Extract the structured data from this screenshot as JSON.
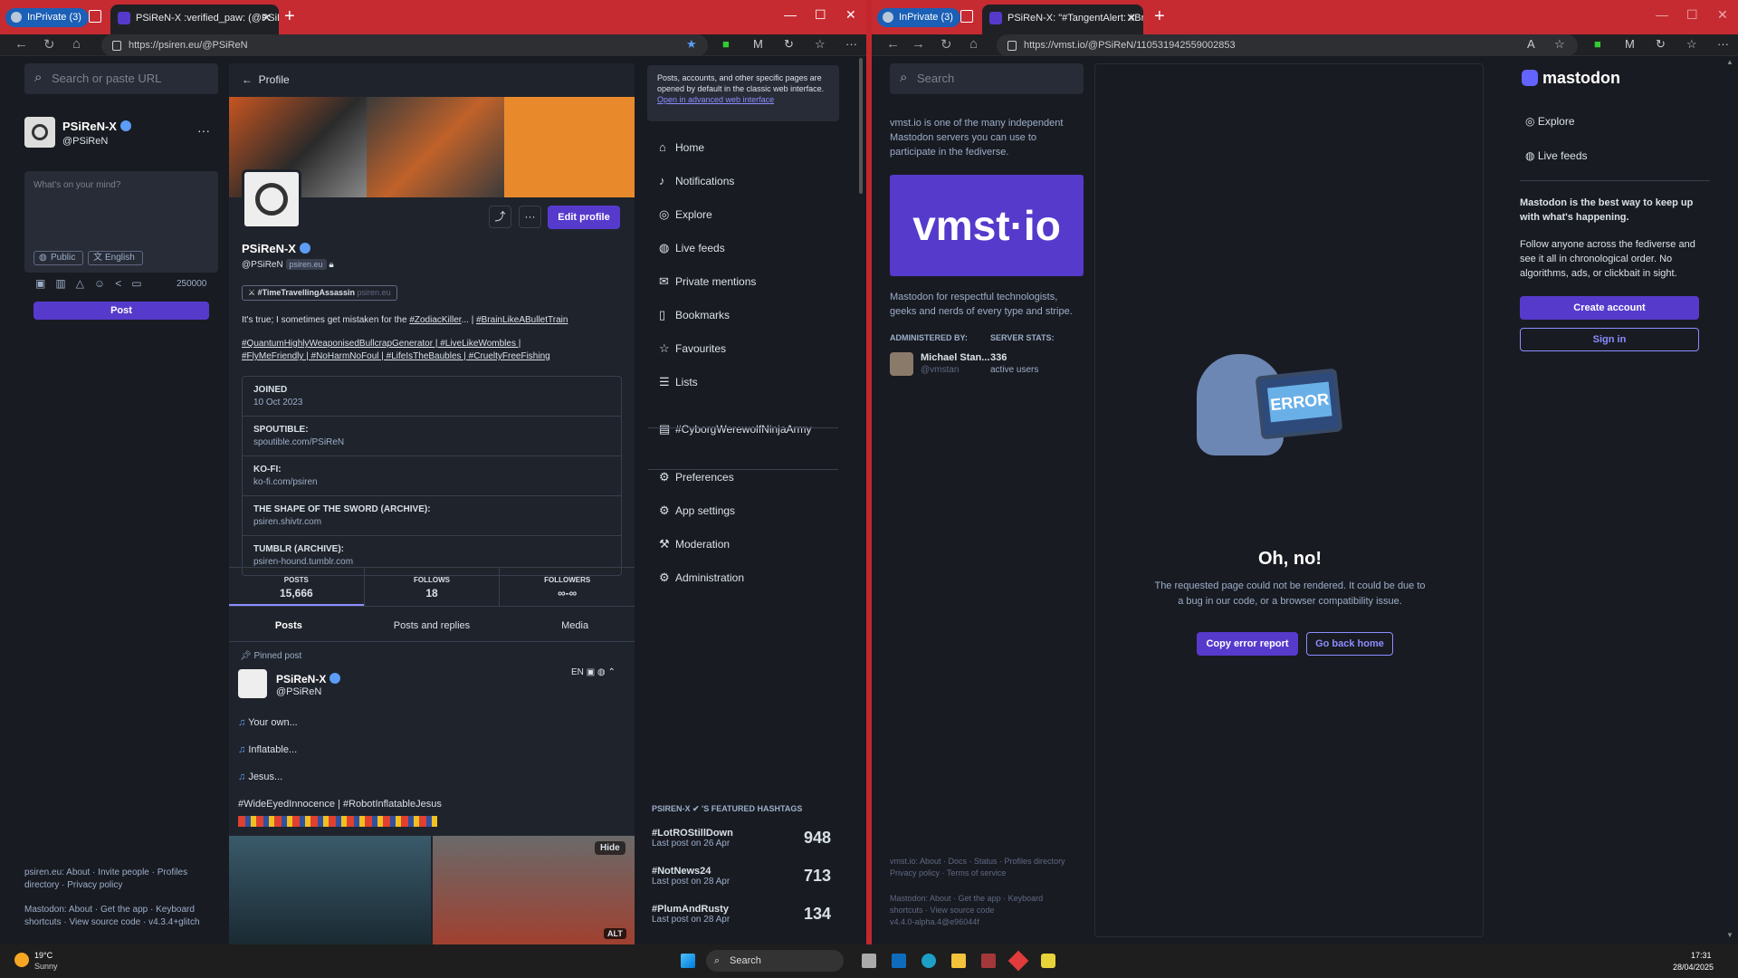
{
  "left_browser": {
    "inprivate": "InPrivate (3)",
    "tab_title": "PSiReN-X :verified_paw: (@PSiRe…",
    "url": "https://psiren.eu/@PSiReN"
  },
  "right_browser": {
    "inprivate": "InPrivate (3)",
    "tab_title": "PSiReN-X: \"#TangentAlert: #Braci…",
    "url": "https://vmst.io/@PSiReN/110531942559002853"
  },
  "compose": {
    "search_placeholder": "Search or paste URL",
    "account_name": "PSiReN-X",
    "account_handle": "@PSiReN",
    "textarea_placeholder": "What's on your mind?",
    "visibility": "Public",
    "language": "English",
    "char_count": "250000",
    "post_label": "Post"
  },
  "profile": {
    "back_label": "Profile",
    "edit_label": "Edit profile",
    "display_name": "PSiReN-X",
    "handle": "@PSiReN",
    "domain_badge": "psiren.eu",
    "featured_tag": "#TimeTravellingAssassin",
    "featured_tag_domain": "psiren.eu",
    "bio_line1_text": "It's true; I sometimes get mistaken for the ",
    "bio_line1_link1": "#ZodiacKiller",
    "bio_line1_mid": "... | ",
    "bio_line1_link2": "#BrainLikeABulletTrain",
    "bio_line2": "#QuantumHighlyWeaponisedBullcrapGenerator | #LiveLikeWombles |",
    "bio_line3": "#FlyMeFriendly | #NoHarmNoFoul | #LifeIsTheBaubles | #CrueltyFreeFishing",
    "fields": [
      {
        "k": "JOINED",
        "v": "10 Oct 2023"
      },
      {
        "k": "SPOUTIBLE:",
        "v": "spoutible.com/PSiReN"
      },
      {
        "k": "KO-FI:",
        "v": "ko-fi.com/psiren"
      },
      {
        "k": "THE SHAPE OF THE SWORD (ARCHIVE):",
        "v": "psiren.shivtr.com"
      },
      {
        "k": "TUMBLR (ARCHIVE):",
        "v": "psiren-hound.tumblr.com"
      }
    ],
    "stats": [
      {
        "label": "POSTS",
        "value": "15,666"
      },
      {
        "label": "FOLLOWS",
        "value": "18"
      },
      {
        "label": "FOLLOWERS",
        "value": "∞-∞"
      }
    ],
    "tabs": [
      "Posts",
      "Posts and replies",
      "Media"
    ],
    "pinned_label": "Pinned post",
    "post_author": "PSiReN-X",
    "post_handle": "@PSiReN",
    "post_lang": "EN",
    "post_lines": [
      "Your own...",
      "Inflatable...",
      "Jesus..."
    ],
    "post_tags": "#WideEyedInnocence | #RobotInflatableJesus",
    "hide_label": "Hide",
    "alt_label": "ALT"
  },
  "left_footer": {
    "line1": "psiren.eu: About · Invite people · Profiles directory · Privacy policy",
    "line2": "Mastodon: About · Get the app · Keyboard shortcuts · View source code · v4.3.4+glitch"
  },
  "sidebar": {
    "notice": "Posts, accounts, and other specific pages are opened by default in the classic web interface.",
    "notice_link": "Open in advanced web interface",
    "items": [
      "Home",
      "Notifications",
      "Explore",
      "Live feeds",
      "Private mentions",
      "Bookmarks",
      "Favourites",
      "Lists",
      "#CyborgWerewolfNinjaArmy",
      "Preferences",
      "App settings",
      "Moderation",
      "Administration"
    ],
    "icons": [
      "home-icon",
      "bell-icon",
      "compass-icon",
      "globe-icon",
      "mail-icon",
      "bookmark-icon",
      "star-icon",
      "list-icon",
      "hashtag-icon",
      "gear-icon",
      "sliders-icon",
      "gavel-icon",
      "cogs-icon"
    ],
    "featured_heading": "PSIREN-X ✔ 'S FEATURED HASHTAGS",
    "featured": [
      {
        "tag": "#LotROStillDown",
        "sub": "Last post on 26 Apr",
        "count": "948"
      },
      {
        "tag": "#NotNews24",
        "sub": "Last post on 28 Apr",
        "count": "713"
      },
      {
        "tag": "#PlumAndRusty",
        "sub": "Last post on 28 Apr",
        "count": "134"
      }
    ]
  },
  "right": {
    "search_placeholder": "Search",
    "about_server": "vmst.io is one of the many independent Mastodon servers you can use to participate in the fediverse.",
    "logo_text": "vmst·io",
    "server_desc": "Mastodon for respectful technologists, geeks and nerds of every type and stripe.",
    "admin_label": "ADMINISTERED BY:",
    "stats_label": "SERVER STATS:",
    "admin_name": "Michael Stan...",
    "admin_handle": "@vmstan",
    "active_count": "336",
    "active_label": "active users",
    "error_screen": "ERROR",
    "error_title": "Oh, no!",
    "error_text1": "The requested page could not be rendered. It could be due to",
    "error_text2": "a bug in our code, or a browser compatibility issue.",
    "copy_label": "Copy error report",
    "home_label": "Go back home",
    "footer1": "vmst.io: About · Docs · Status · Profiles directory",
    "footer2": "Privacy policy · Terms of service",
    "footer3": "Mastodon: About · Get the app · Keyboard",
    "footer4": "shortcuts · View source code",
    "footer5": "v4.4.0-alpha.4@e96044f",
    "brand": "mastodon",
    "nav": [
      "Explore",
      "Live feeds"
    ],
    "promo_title": "Mastodon is the best way to keep up with what's happening.",
    "promo_text": "Follow anyone across the fediverse and see it all in chronological order. No algorithms, ads, or clickbait in sight.",
    "create_label": "Create account",
    "signin_label": "Sign in"
  },
  "taskbar": {
    "temp": "19°C",
    "weather": "Sunny",
    "search": "Search",
    "time": "17:31",
    "date": "28/04/2025"
  }
}
